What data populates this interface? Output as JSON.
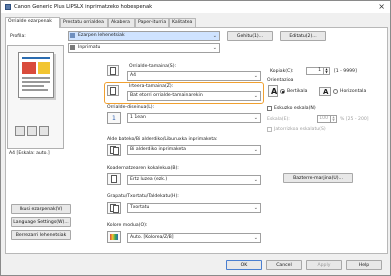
{
  "window": {
    "title": "Canon Generic Plus LIPSLX inprimatzeko hobespenak"
  },
  "tabs": [
    {
      "label": "Orrialde ezarpenak"
    },
    {
      "label": "Prestatu orrialdea"
    },
    {
      "label": "Akabera"
    },
    {
      "label": "Paper-iturria"
    },
    {
      "label": "Kalitatea"
    }
  ],
  "profile": {
    "label": "Profila:",
    "value": "Ezarpen lehenetsiak",
    "edit_label": "Gehitu(1)...",
    "edit2_label": "Editatu(2)..."
  },
  "output_method": {
    "label": "Irteera-metodoa:",
    "value": "Inprimatu"
  },
  "original_size": {
    "label": "Orrialde-tamaina(S):",
    "value": "A4"
  },
  "output_size": {
    "label": "Irteera-tamaina(Z):",
    "value": "Bat etorri orrialde-tamainarekin"
  },
  "copies": {
    "label": "Kopiak(C):",
    "value": "1",
    "range": "[1 - 9999]"
  },
  "orientation": {
    "label": "Orientazioa",
    "options": [
      {
        "label": "Bertikala"
      },
      {
        "label": "Horizontala"
      }
    ]
  },
  "pages_per_sheet": {
    "label": "Orrialde-diseinua(L):",
    "value": "1 1ean"
  },
  "manual_scaling": {
    "label": "Eskuzko eskala(N)",
    "scaling_label": "Eskala(E):",
    "scaling_value": "100",
    "scaling_range": "% [25 - 200]",
    "zoom_label": "Jatorrizkoa eskalatu(S)"
  },
  "duplex": {
    "label": "Alde bateko/Bi alderdiko/Liburuxka inprimaketa:",
    "value": "Bi alderdiko inprimaketa"
  },
  "binding": {
    "label": "Koadernatzearen kokalekua(B):",
    "value": "Ertz luzea (ezk.)"
  },
  "binding_margin_label": "Bazterre-marjina(U)...",
  "staple": {
    "label": "Grapatu/Txortatu/Taldekatu(H):",
    "value": "Txortatu"
  },
  "color_mode": {
    "label": "Kolore modua(O):",
    "value": "Auto. [Kolorea/Z/B]"
  },
  "preview_caption": "A4 [Eskala: auto.]",
  "left_buttons": [
    {
      "label": "Ikusi ezarpenak(V)"
    },
    {
      "label": "Language Settings(W)..."
    },
    {
      "label": "Berrezarri lehenetsiak"
    }
  ],
  "bottom_buttons": [
    {
      "label": "OK"
    },
    {
      "label": "Cancel"
    },
    {
      "label": "Apply"
    },
    {
      "label": "Help"
    }
  ],
  "colors": {
    "highlight": "#f0a030",
    "selection": "#cfe3ff"
  }
}
